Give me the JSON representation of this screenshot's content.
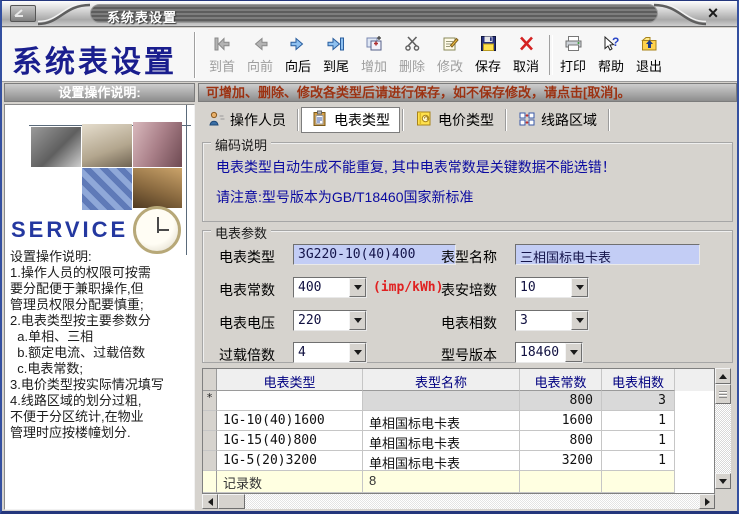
{
  "window": {
    "title": "系统表设置",
    "close_glyph": "×"
  },
  "header": {
    "app_title": "系统表设置"
  },
  "toolbar": {
    "buttons": [
      {
        "label": "到首",
        "icon": "first-icon",
        "enabled": false
      },
      {
        "label": "向前",
        "icon": "prev-icon",
        "enabled": false
      },
      {
        "label": "向后",
        "icon": "next-icon",
        "enabled": true
      },
      {
        "label": "到尾",
        "icon": "last-icon",
        "enabled": true
      },
      {
        "label": "增加",
        "icon": "add-icon",
        "enabled": false
      },
      {
        "label": "删除",
        "icon": "delete-icon",
        "enabled": false
      },
      {
        "label": "修改",
        "icon": "modify-icon",
        "enabled": false
      },
      {
        "label": "保存",
        "icon": "save-icon",
        "enabled": true
      },
      {
        "label": "取消",
        "icon": "cancel-icon",
        "enabled": true
      },
      {
        "label": "打印",
        "icon": "print-icon",
        "enabled": true
      },
      {
        "label": "帮助",
        "icon": "help-icon",
        "enabled": true
      },
      {
        "label": "退出",
        "icon": "exit-icon",
        "enabled": true
      }
    ]
  },
  "sidebar": {
    "header": "设置操作说明:",
    "service_label": "SERVICE",
    "instructions": [
      "设置操作说明:",
      "1.操作人员的权限可按需",
      "要分配便于兼职操作,但",
      "管理员权限分配要慎重;",
      "2.电表类型按主要参数分",
      "  a.单相、三相",
      "  b.额定电流、过载倍数",
      "  c.电表常数;",
      "3.电价类型按实际情况填写",
      "4.线路区域的划分过粗,",
      "不便于分区统计,在物业",
      "管理时应按楼幢划分."
    ]
  },
  "main": {
    "notice": "可增加、删除、修改各类型后请进行保存，如不保存修改，请点击[取消]。",
    "tabs": [
      {
        "label": "操作人员",
        "icon": "operator-icon",
        "selected": false
      },
      {
        "label": "电表类型",
        "icon": "meter-type-icon",
        "selected": true
      },
      {
        "label": "电价类型",
        "icon": "price-type-icon",
        "selected": false
      },
      {
        "label": "线路区域",
        "icon": "line-area-icon",
        "selected": false
      }
    ],
    "coding": {
      "title": "编码说明",
      "lines": [
        "电表类型自动生成不能重复, 其中电表常数是关键数据不能选错！",
        "请注意:型号版本为GB/T18460国家新标准"
      ]
    },
    "params": {
      "title": "电表参数",
      "meter_type": {
        "label": "电表类型",
        "value": "3G220-10(40)400"
      },
      "model_name": {
        "label": "表型名称",
        "value": "三相国标电卡表"
      },
      "meter_constant": {
        "label": "电表常数",
        "value": "400",
        "unit": "(imp/kWh)"
      },
      "ampere": {
        "label": "表安培数",
        "value": "10"
      },
      "voltage": {
        "label": "电表电压",
        "value": "220"
      },
      "phases": {
        "label": "电表相数",
        "value": "3"
      },
      "overload": {
        "label": "过载倍数",
        "value": "4"
      },
      "model_version": {
        "label": "型号版本",
        "value": "18460"
      }
    },
    "grid": {
      "columns": [
        "电表类型",
        "表型名称",
        "电表常数",
        "电表相数"
      ],
      "new_row": {
        "selector": "*",
        "type": "",
        "name": "",
        "constant": "800",
        "phases": "3"
      },
      "rows": [
        {
          "type": "1G-10(40)1600",
          "name": "单相国标电卡表",
          "constant": "1600",
          "phases": "1"
        },
        {
          "type": "1G-15(40)800",
          "name": "单相国标电卡表",
          "constant": "800",
          "phases": "1"
        },
        {
          "type": "1G-5(20)3200",
          "name": "单相国标电卡表",
          "constant": "3200",
          "phases": "1"
        }
      ],
      "footer": {
        "label": "记录数",
        "value": "8"
      }
    }
  },
  "colors": {
    "title_text": "#1a1e8e",
    "input_bg": "#c3cdf5",
    "info_text": "#0a0aa0",
    "unit_text": "#e02020",
    "notice_text": "#9c3212",
    "grid_header_text": "#000080",
    "footer_row_bg": "#ffffe1"
  }
}
